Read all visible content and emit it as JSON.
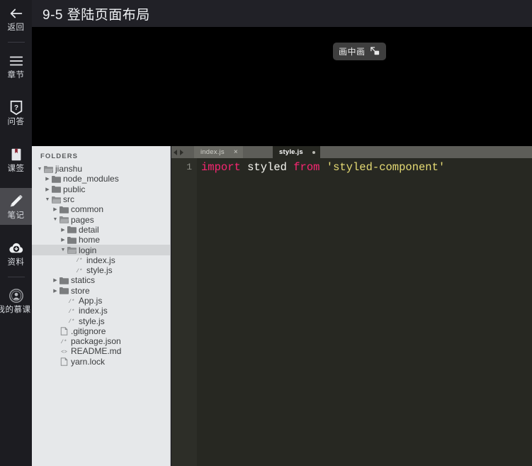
{
  "header": {
    "title": "9-5 登陆页面布局"
  },
  "rail": {
    "items": [
      {
        "label": "返回",
        "icon": "back-arrow-icon",
        "active": false
      },
      {
        "label": "章节",
        "icon": "menu-icon",
        "active": false
      },
      {
        "label": "问答",
        "icon": "question-mark-icon",
        "active": false
      },
      {
        "label": "课签",
        "icon": "bookmark-book-icon",
        "active": false
      },
      {
        "label": "笔记",
        "icon": "pencil-icon",
        "active": true
      },
      {
        "label": "资料",
        "icon": "download-cloud-icon",
        "active": false
      },
      {
        "label": "我的慕课",
        "icon": "mooc-avatar-icon",
        "active": false
      }
    ]
  },
  "video": {
    "pip": {
      "label": "画中画",
      "icon": "picture-in-picture-icon"
    }
  },
  "files": {
    "header": "FOLDERS",
    "rows": [
      {
        "label": "jianshu",
        "indent": 0,
        "twisty": "open",
        "icon": "folder-open-icon",
        "selected": false
      },
      {
        "label": "node_modules",
        "indent": 1,
        "twisty": "closed",
        "icon": "folder-closed-icon",
        "selected": false
      },
      {
        "label": "public",
        "indent": 1,
        "twisty": "closed",
        "icon": "folder-closed-icon",
        "selected": false
      },
      {
        "label": "src",
        "indent": 1,
        "twisty": "open",
        "icon": "folder-open-icon",
        "selected": false
      },
      {
        "label": "common",
        "indent": 2,
        "twisty": "closed",
        "icon": "folder-closed-icon",
        "selected": false
      },
      {
        "label": "pages",
        "indent": 2,
        "twisty": "open",
        "icon": "folder-open-icon",
        "selected": false
      },
      {
        "label": "detail",
        "indent": 3,
        "twisty": "closed",
        "icon": "folder-closed-icon",
        "selected": false
      },
      {
        "label": "home",
        "indent": 3,
        "twisty": "closed",
        "icon": "folder-closed-icon",
        "selected": false
      },
      {
        "label": "login",
        "indent": 3,
        "twisty": "open",
        "icon": "folder-open-icon",
        "selected": true
      },
      {
        "label": "index.js",
        "indent": 4,
        "twisty": "none",
        "icon": "js-file-icon",
        "selected": false
      },
      {
        "label": "style.js",
        "indent": 4,
        "twisty": "none",
        "icon": "js-file-icon",
        "selected": false
      },
      {
        "label": "statics",
        "indent": 2,
        "twisty": "closed",
        "icon": "folder-closed-icon",
        "selected": false
      },
      {
        "label": "store",
        "indent": 2,
        "twisty": "closed",
        "icon": "folder-closed-icon",
        "selected": false
      },
      {
        "label": "App.js",
        "indent": 3,
        "twisty": "none",
        "icon": "js-file-icon",
        "selected": false
      },
      {
        "label": "index.js",
        "indent": 3,
        "twisty": "none",
        "icon": "js-file-icon",
        "selected": false
      },
      {
        "label": "style.js",
        "indent": 3,
        "twisty": "none",
        "icon": "js-file-icon",
        "selected": false
      },
      {
        "label": ".gitignore",
        "indent": 2,
        "twisty": "none",
        "icon": "doc-file-icon",
        "selected": false
      },
      {
        "label": "package.json",
        "indent": 2,
        "twisty": "none",
        "icon": "js-file-icon",
        "selected": false
      },
      {
        "label": "README.md",
        "indent": 2,
        "twisty": "none",
        "icon": "markdown-file-icon",
        "selected": false
      },
      {
        "label": "yarn.lock",
        "indent": 2,
        "twisty": "none",
        "icon": "doc-file-icon",
        "selected": false
      }
    ]
  },
  "editor": {
    "nav": {
      "back": "back-arrow-icon",
      "forward": "forward-arrow-icon"
    },
    "tabs": [
      {
        "label": "index.js",
        "active": false,
        "close": "×",
        "dirty": false
      },
      {
        "label": "style.js",
        "active": true,
        "close": null,
        "dirty": true
      }
    ],
    "line_number": "1",
    "code": {
      "kw_import": "import",
      "sp1": " ",
      "id_styled": "styled",
      "sp2": " ",
      "kw_from": "from",
      "sp3": " ",
      "str_module": "'styled-component'"
    },
    "colors": {
      "background": "#272822",
      "keyword": "#f92672",
      "identifier": "#f8f8f2",
      "string": "#e6db74",
      "gutter_text": "#8e8f87"
    }
  }
}
